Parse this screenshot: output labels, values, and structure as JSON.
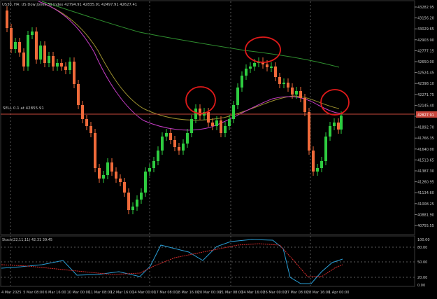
{
  "header": {
    "symbol_info": "US30, H4:  US Dow Jones 30 Index  42794.91 42835.91 42497.91 42627.41",
    "sell_label": "SELL 0.1 at 42855.91"
  },
  "price_axis": {
    "labels": [
      "43282.95",
      "43156.20",
      "43029.65",
      "42903.90",
      "42777.15",
      "42650.00",
      "42524.45",
      "42398.10",
      "42271.75",
      "42145.40",
      "42019.05",
      "41892.70",
      "41766.35",
      "41640.00",
      "41513.65",
      "41387.30",
      "41260.95",
      "41134.60",
      "41008.25",
      "40881.90",
      "40755.55"
    ],
    "current_price": "42827.91"
  },
  "oscillator": {
    "title": "Stoch(22,11,11) 42.31 39.45",
    "levels": [
      "100.00",
      "80.00",
      "50.00",
      "20.00",
      "0.00"
    ]
  },
  "time_axis": {
    "labels": [
      "4 Mar 2025",
      "5 Mar 08:00",
      "6 Mar 16:00",
      "10 Mar 00:00",
      "11 Mar 08:00",
      "12 Mar 16:00",
      "14 Mar 00:00",
      "17 Mar 08:00",
      "18 Mar 16:00",
      "20 Mar 00:00",
      "21 Mar 08:00",
      "24 Mar 16:00",
      "26 Mar 00:00",
      "27 Mar 08:00",
      "28 Mar 16:00",
      "1 Apr 00:00"
    ]
  },
  "colors": {
    "background": "#000000",
    "bull": "#2ecc40",
    "bear": "#f06a3a",
    "grid": "#5a5a5a",
    "ma_long": "#2f8f2f",
    "ma_mid": "#9b8f2e",
    "ma_short": "#c33cc3",
    "order_line": "#c9473d",
    "circle": "#e01a1a",
    "stoch_main": "#2a9fd6",
    "stoch_signal": "#d32b2b",
    "text": "#c8c8c8"
  },
  "icons": [
    "buy-sell-markers"
  ]
}
